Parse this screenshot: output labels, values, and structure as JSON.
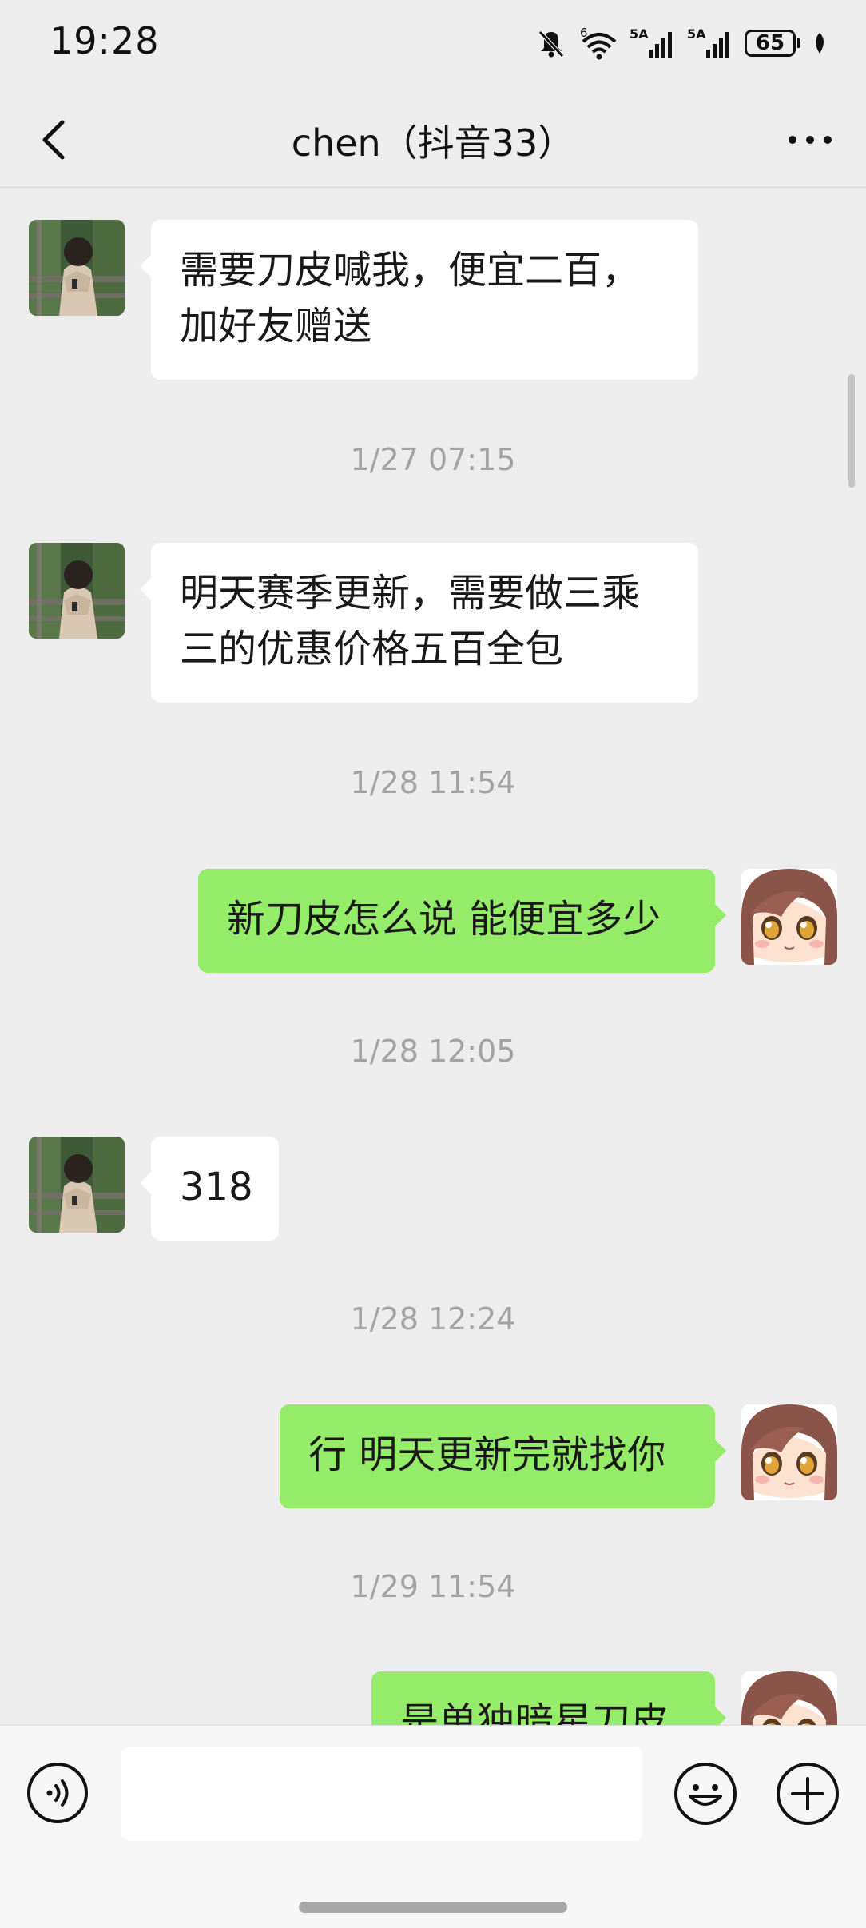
{
  "status_bar": {
    "time": "19:28",
    "signal_1_label": "5A",
    "signal_2_label": "5A",
    "wifi_badge": "6",
    "battery_level": "65",
    "icons": [
      "mute-bell-icon",
      "wifi-icon",
      "signal-icon",
      "signal-icon",
      "battery-icon",
      "leaf-icon"
    ]
  },
  "header": {
    "title": "chen（抖音33）",
    "back_icon": "chevron-left-icon",
    "more_icon": "more-dots-icon"
  },
  "messages": [
    {
      "type": "in",
      "lines": [
        "需要刀皮喊我，便宜二百，",
        "加好友赠送"
      ]
    },
    {
      "type": "time",
      "text": "1/27 07:15"
    },
    {
      "type": "in",
      "lines": [
        "明天赛季更新，需要做三乘",
        "三的优惠价格五百全包"
      ]
    },
    {
      "type": "time",
      "text": "1/28 11:54"
    },
    {
      "type": "out",
      "lines": [
        "新刀皮怎么说 能便宜多少"
      ]
    },
    {
      "type": "time",
      "text": "1/28 12:05"
    },
    {
      "type": "in",
      "lines": [
        "318"
      ]
    },
    {
      "type": "time",
      "text": "1/28 12:24"
    },
    {
      "type": "out",
      "lines": [
        "行 明天更新完就找你"
      ]
    },
    {
      "type": "time",
      "text": "1/29 11:54"
    },
    {
      "type": "out",
      "lines": [
        "是单独暗星刀皮"
      ]
    }
  ],
  "input_bar": {
    "text_value": "",
    "voice_icon": "voice-icon",
    "emoji_icon": "emoji-icon",
    "plus_icon": "plus-icon"
  },
  "colors": {
    "background": "#ededed",
    "incoming_bubble": "#ffffff",
    "outgoing_bubble": "#95ec69",
    "timestamp": "#a3a3a3"
  }
}
